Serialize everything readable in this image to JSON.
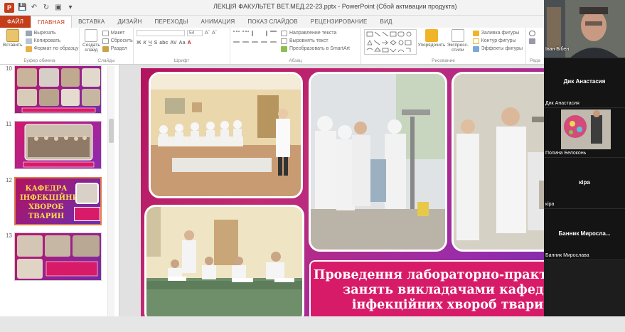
{
  "window": {
    "title": "ЛЕКЦІЯ ФАКУЛЬТЕТ ВЕТ.МЕД.22-23.pptx - PowerPoint (Сбой активации продукта)"
  },
  "ribbon_tabs": [
    {
      "label": "ФАЙЛ"
    },
    {
      "label": "ГЛАВНАЯ"
    },
    {
      "label": "ВСТАВКА"
    },
    {
      "label": "ДИЗАЙН"
    },
    {
      "label": "ПЕРЕХОДЫ"
    },
    {
      "label": "АНИМАЦИЯ"
    },
    {
      "label": "ПОКАЗ СЛАЙДОВ"
    },
    {
      "label": "РЕЦЕНЗИРОВАНИЕ"
    },
    {
      "label": "ВИД"
    }
  ],
  "ribbon": {
    "clipboard": {
      "paste": "Вставить",
      "cut": "Вырезать",
      "copy": "Копировать",
      "format_painter": "Формат по образцу",
      "group": "Буфер обмена"
    },
    "slides": {
      "new_slide": "Создать слайд",
      "layout": "Макет",
      "reset": "Сбросить",
      "section": "Раздел",
      "group": "Слайды"
    },
    "font": {
      "size": "54",
      "group": "Шрифт"
    },
    "paragraph": {
      "text_direction": "Направление текста",
      "align_text": "Выровнять текст",
      "smartart": "Преобразовать в SmartArt",
      "group": "Абзац"
    },
    "drawing": {
      "arrange": "Упорядочить",
      "quick_styles": "Экспресс-стили",
      "shape_fill": "Заливка фигуры",
      "shape_outline": "Контур фигуры",
      "shape_effects": "Эффекты фигуры",
      "group": "Рисование"
    },
    "editing": {
      "group": "Реда"
    }
  },
  "thumbnails": [
    {
      "number": "10"
    },
    {
      "number": "11"
    },
    {
      "number": "12",
      "text": "КАФЕДРА ІНФЕКЦІЙНИХ ХВОРОБ ТВАРИН"
    },
    {
      "number": "13"
    }
  ],
  "slide": {
    "caption_lines": [
      "Проведення лабораторно-практичних",
      "занять викладачами кафедри",
      "інфекційних хвороб тварин"
    ]
  },
  "conference": {
    "participants": [
      {
        "label": "Іван Бібен"
      },
      {
        "center": "Дик Анастасия",
        "corner": "Дик Анастасия"
      },
      {
        "corner": "Полина Белоконь"
      },
      {
        "center": "кіра",
        "corner": "кіра"
      },
      {
        "center": "Банник Миросла...",
        "corner": "Банник Мирослава"
      }
    ]
  },
  "colors": {
    "accent": "#c43e1c",
    "caption_fill": "#d81b68",
    "slide_bg_start": "#b2125e",
    "slide_bg_end": "#6b2fb3"
  }
}
